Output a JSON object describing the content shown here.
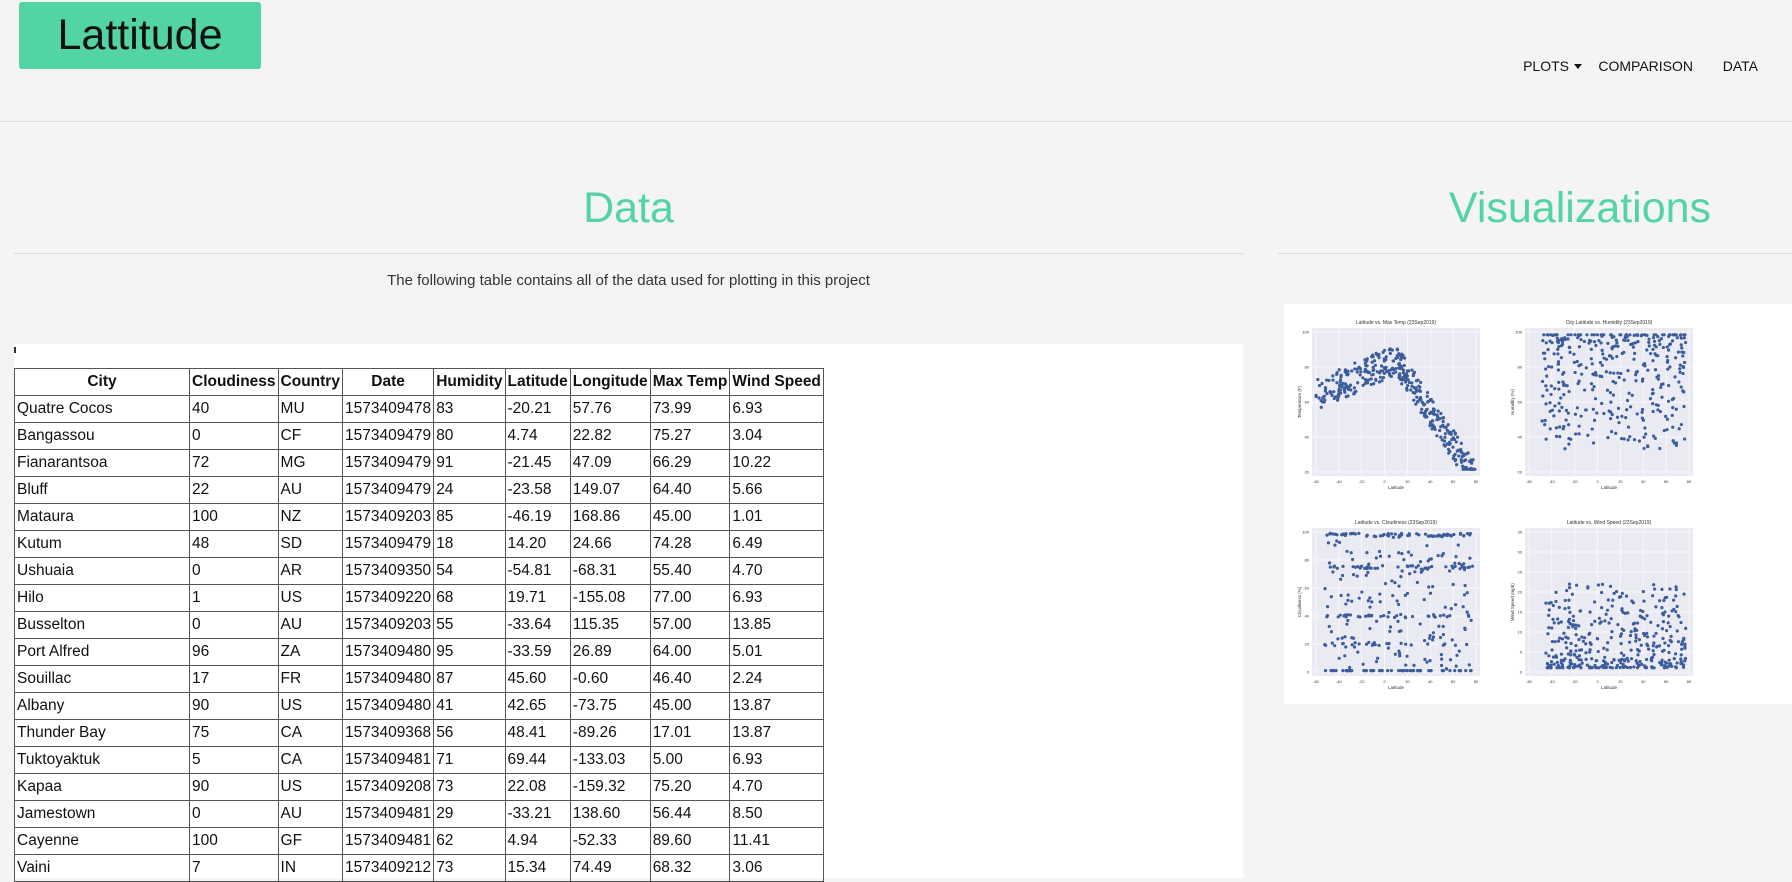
{
  "nav": {
    "brand": "Lattitude",
    "items": [
      {
        "label": "PLOTS",
        "dropdown": true
      },
      {
        "label": "COMPARISON",
        "dropdown": false
      },
      {
        "label": "DATA",
        "dropdown": false
      }
    ]
  },
  "data_section": {
    "heading": "Data",
    "description": "The following table contains all of the data used for plotting in this project"
  },
  "viz_section": {
    "heading": "Visualizations",
    "plots": [
      {
        "title": "Latitude vs. Max Temp (23Sep2019)",
        "xlabel": "Latitude",
        "ylabel": "Temperature (F)",
        "y_ticks": [
          "100",
          "80",
          "60",
          "40",
          "20"
        ]
      },
      {
        "title": "City Latitude vs. Humidity (23Sep2019)",
        "xlabel": "Latitude",
        "ylabel": "Humidity (%)",
        "y_ticks": [
          "100",
          "80",
          "60",
          "40",
          "20"
        ]
      },
      {
        "title": "Latitude vs. Cloudiness (23Sep2019)",
        "xlabel": "Latitude",
        "ylabel": "Cloudiness (%)",
        "y_ticks": [
          "100",
          "80",
          "60",
          "40",
          "20",
          "0"
        ]
      },
      {
        "title": "Latitude vs. Wind Speed (23Sep2019)",
        "xlabel": "Latitude",
        "ylabel": "Wind Speed (mph)",
        "y_ticks": [
          "35",
          "30",
          "25",
          "20",
          "15",
          "10",
          "5",
          "0"
        ]
      }
    ],
    "x_ticks": [
      "-60",
      "-40",
      "-20",
      "0",
      "20",
      "40",
      "60",
      "80"
    ],
    "point_color": "#3c5d9c"
  },
  "table": {
    "columns": [
      "City",
      "Cloudiness",
      "Country",
      "Date",
      "Humidity",
      "Latitude",
      "Longitude",
      "Max Temp",
      "Wind Speed"
    ],
    "rows": [
      [
        "Quatre Cocos",
        "40",
        "MU",
        "1573409478",
        "83",
        "-20.21",
        "57.76",
        "73.99",
        "6.93"
      ],
      [
        "Bangassou",
        "0",
        "CF",
        "1573409479",
        "80",
        "4.74",
        "22.82",
        "75.27",
        "3.04"
      ],
      [
        "Fianarantsoa",
        "72",
        "MG",
        "1573409479",
        "91",
        "-21.45",
        "47.09",
        "66.29",
        "10.22"
      ],
      [
        "Bluff",
        "22",
        "AU",
        "1573409479",
        "24",
        "-23.58",
        "149.07",
        "64.40",
        "5.66"
      ],
      [
        "Mataura",
        "100",
        "NZ",
        "1573409203",
        "85",
        "-46.19",
        "168.86",
        "45.00",
        "1.01"
      ],
      [
        "Kutum",
        "48",
        "SD",
        "1573409479",
        "18",
        "14.20",
        "24.66",
        "74.28",
        "6.49"
      ],
      [
        "Ushuaia",
        "0",
        "AR",
        "1573409350",
        "54",
        "-54.81",
        "-68.31",
        "55.40",
        "4.70"
      ],
      [
        "Hilo",
        "1",
        "US",
        "1573409220",
        "68",
        "19.71",
        "-155.08",
        "77.00",
        "6.93"
      ],
      [
        "Busselton",
        "0",
        "AU",
        "1573409203",
        "55",
        "-33.64",
        "115.35",
        "57.00",
        "13.85"
      ],
      [
        "Port Alfred",
        "96",
        "ZA",
        "1573409480",
        "95",
        "-33.59",
        "26.89",
        "64.00",
        "5.01"
      ],
      [
        "Souillac",
        "17",
        "FR",
        "1573409480",
        "87",
        "45.60",
        "-0.60",
        "46.40",
        "2.24"
      ],
      [
        "Albany",
        "90",
        "US",
        "1573409480",
        "41",
        "42.65",
        "-73.75",
        "45.00",
        "13.87"
      ],
      [
        "Thunder Bay",
        "75",
        "CA",
        "1573409368",
        "56",
        "48.41",
        "-89.26",
        "17.01",
        "13.87"
      ],
      [
        "Tuktoyaktuk",
        "5",
        "CA",
        "1573409481",
        "71",
        "69.44",
        "-133.03",
        "5.00",
        "6.93"
      ],
      [
        "Kapaa",
        "90",
        "US",
        "1573409208",
        "73",
        "22.08",
        "-159.32",
        "75.20",
        "4.70"
      ],
      [
        "Jamestown",
        "0",
        "AU",
        "1573409481",
        "29",
        "-33.21",
        "138.60",
        "56.44",
        "8.50"
      ],
      [
        "Cayenne",
        "100",
        "GF",
        "1573409481",
        "62",
        "4.94",
        "-52.33",
        "89.60",
        "11.41"
      ],
      [
        "Vaini",
        "7",
        "IN",
        "1573409212",
        "73",
        "15.34",
        "74.49",
        "68.32",
        "3.06"
      ]
    ]
  }
}
